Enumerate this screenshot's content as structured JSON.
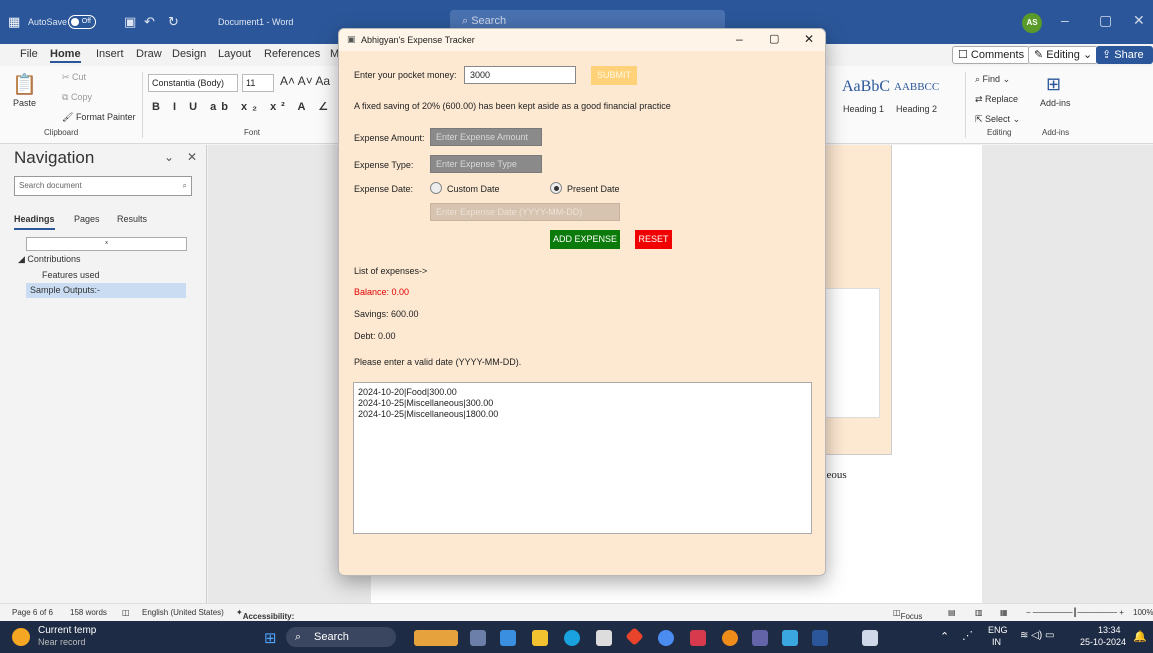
{
  "word": {
    "title_bar": {
      "autosave_label": "AutoSave",
      "autosave_state": "Off",
      "doc_title": "Document1 - Word",
      "search_placeholder": "Search",
      "user_initials": "AS"
    },
    "menu": [
      "File",
      "Home",
      "Insert",
      "Draw",
      "Design",
      "Layout",
      "References",
      "M"
    ],
    "right_buttons": {
      "comments": "Comments",
      "editing": "Editing",
      "share": "Share"
    },
    "ribbon": {
      "paste": "Paste",
      "cut": "Cut",
      "copy": "Copy",
      "format_painter": "Format Painter",
      "clipboard_group": "Clipboard",
      "font_name": "Constantia (Body)",
      "font_size": "11",
      "font_group": "Font",
      "style_sample_1": "AaBbC",
      "style_sample_2": "AABBCC",
      "heading1": "Heading 1",
      "heading2": "Heading 2",
      "find": "Find",
      "replace": "Replace",
      "select": "Select",
      "editing_group": "Editing",
      "addins": "Add-ins",
      "addins_group": "Add-ins"
    },
    "navigation": {
      "title": "Navigation",
      "search_placeholder": "Search document",
      "tabs": [
        "Headings",
        "Pages",
        "Results"
      ],
      "items": [
        "Contributions",
        "Features used",
        "Sample Outputs:-"
      ]
    },
    "doc_text_fragment": "llaneous",
    "status_bar": {
      "page": "Page 6 of 6",
      "words": "158 words",
      "language": "English (United States)",
      "accessibility": "Accessibility: Investigate",
      "focus": "Focus",
      "zoom": "100%"
    }
  },
  "tracker": {
    "window_title": "Abhigyan's Expense Tracker",
    "pocket_money_label": "Enter your pocket money:",
    "pocket_money_value": "3000",
    "submit_label": "SUBMIT",
    "saving_message": "A fixed saving of 20% (600.00) has been kept aside as a good financial practice",
    "expense_amount_label": "Expense Amount:",
    "expense_amount_placeholder": "Enter Expense Amount",
    "expense_type_label": "Expense Type:",
    "expense_type_placeholder": "Enter Expense Type",
    "expense_date_label": "Expense Date:",
    "custom_date_label": "Custom Date",
    "present_date_label": "Present Date",
    "date_mode_selected": "Present Date",
    "date_placeholder": "Enter Expense Date (YYYY-MM-DD)",
    "add_expense_label": "ADD EXPENSE",
    "reset_label": "RESET",
    "list_label": "List of expenses->",
    "balance": "Balance: 0.00",
    "savings": "Savings: 600.00",
    "debt": "Debt: 0.00",
    "message": "Please enter a valid date (YYYY-MM-DD).",
    "expenses": [
      "2024-10-20|Food|300.00",
      "2024-10-25|Miscellaneous|300.00",
      "2024-10-25|Miscellaneous|1800.00"
    ],
    "colors": {
      "add": "#0a7a0a",
      "reset": "#f00000",
      "submit": "#ffd27a",
      "balance": "#e00000"
    }
  },
  "taskbar": {
    "weather_title": "Current temp",
    "weather_sub": "Near record",
    "search": "Search",
    "lang_top": "ENG",
    "lang_bottom": "IN",
    "time": "13:34",
    "date": "25-10-2024"
  }
}
